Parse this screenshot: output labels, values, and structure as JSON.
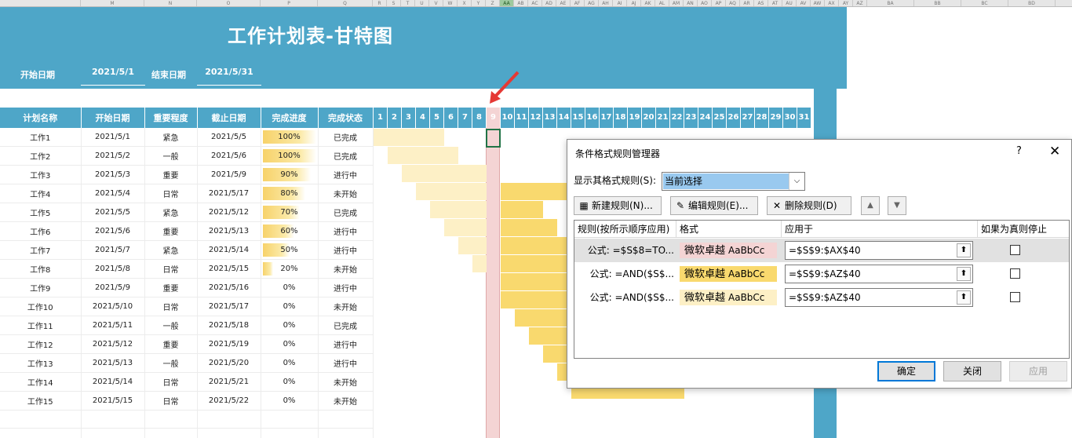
{
  "header": {
    "title": "工作计划表-甘特图",
    "start_label": "开始日期",
    "start_value": "2021/5/1",
    "end_label": "结束日期",
    "end_value": "2021/5/31"
  },
  "column_headers": {
    "selected": "AA"
  },
  "table": {
    "headers": [
      "计划名称",
      "开始日期",
      "重要程度",
      "截止日期",
      "完成进度",
      "完成状态"
    ],
    "rows": [
      [
        "工作1",
        "2021/5/1",
        "紧急",
        "2021/5/5",
        "100%",
        "已完成"
      ],
      [
        "工作2",
        "2021/5/2",
        "一般",
        "2021/5/6",
        "100%",
        "已完成"
      ],
      [
        "工作3",
        "2021/5/3",
        "重要",
        "2021/5/9",
        "90%",
        "进行中"
      ],
      [
        "工作4",
        "2021/5/4",
        "日常",
        "2021/5/17",
        "80%",
        "未开始"
      ],
      [
        "工作5",
        "2021/5/5",
        "紧急",
        "2021/5/12",
        "70%",
        "已完成"
      ],
      [
        "工作6",
        "2021/5/6",
        "重要",
        "2021/5/13",
        "60%",
        "进行中"
      ],
      [
        "工作7",
        "2021/5/7",
        "紧急",
        "2021/5/14",
        "50%",
        "进行中"
      ],
      [
        "工作8",
        "2021/5/8",
        "日常",
        "2021/5/15",
        "20%",
        "未开始"
      ],
      [
        "工作9",
        "2021/5/9",
        "重要",
        "2021/5/16",
        "0%",
        "进行中"
      ],
      [
        "工作10",
        "2021/5/10",
        "日常",
        "2021/5/17",
        "0%",
        "未开始"
      ],
      [
        "工作11",
        "2021/5/11",
        "一般",
        "2021/5/18",
        "0%",
        "已完成"
      ],
      [
        "工作12",
        "2021/5/12",
        "重要",
        "2021/5/19",
        "0%",
        "进行中"
      ],
      [
        "工作13",
        "2021/5/13",
        "一般",
        "2021/5/20",
        "0%",
        "进行中"
      ],
      [
        "工作14",
        "2021/5/14",
        "日常",
        "2021/5/21",
        "0%",
        "未开始"
      ],
      [
        "工作15",
        "2021/5/15",
        "日常",
        "2021/5/22",
        "0%",
        "未开始"
      ]
    ],
    "progress": [
      1.0,
      1.0,
      0.9,
      0.8,
      0.7,
      0.6,
      0.5,
      0.2,
      0,
      0,
      0,
      0,
      0,
      0,
      0
    ]
  },
  "gantt": {
    "days": [
      "1",
      "2",
      "3",
      "4",
      "5",
      "6",
      "7",
      "8",
      "9",
      "10",
      "11",
      "12",
      "13",
      "14",
      "15",
      "16",
      "17",
      "18",
      "19",
      "20",
      "21",
      "22",
      "23",
      "24",
      "25",
      "26",
      "27",
      "28",
      "29",
      "30",
      "31"
    ],
    "highlight_day": 9,
    "colors": {
      "past": "#fdf0c6",
      "future": "#f9d96e",
      "highlight": "#f4d4d4",
      "header": "#4ea6c8"
    }
  },
  "dialog": {
    "title": "条件格式规则管理器",
    "help": "?",
    "close": "✕",
    "show_label": "显示其格式规则(S):",
    "show_value": "当前选择",
    "buttons": {
      "new": "新建规则(N)...",
      "edit": "编辑规则(E)...",
      "delete": "删除规则(D)"
    },
    "columns": {
      "rule": "规则(按所示顺序应用)",
      "format": "格式",
      "applies": "应用于",
      "stop": "如果为真则停止"
    },
    "rules": [
      {
        "formula": "公式: =$S$8=TO...",
        "preview": "微软卓越",
        "preview_en": "AaBbCc",
        "applies": "=$S$9:$AX$40",
        "bg": "#f4d4d4"
      },
      {
        "formula": "公式: =AND($S$...",
        "preview": "微软卓越",
        "preview_en": "AaBbCc",
        "applies": "=$S$9:$AZ$40",
        "bg": "#f9d96e"
      },
      {
        "formula": "公式: =AND($S$...",
        "preview": "微软卓越",
        "preview_en": "AaBbCc",
        "applies": "=$S$9:$AZ$40",
        "bg": "#fdf0c6"
      }
    ],
    "ok": "确定",
    "close_btn": "关闭",
    "apply": "应用"
  }
}
